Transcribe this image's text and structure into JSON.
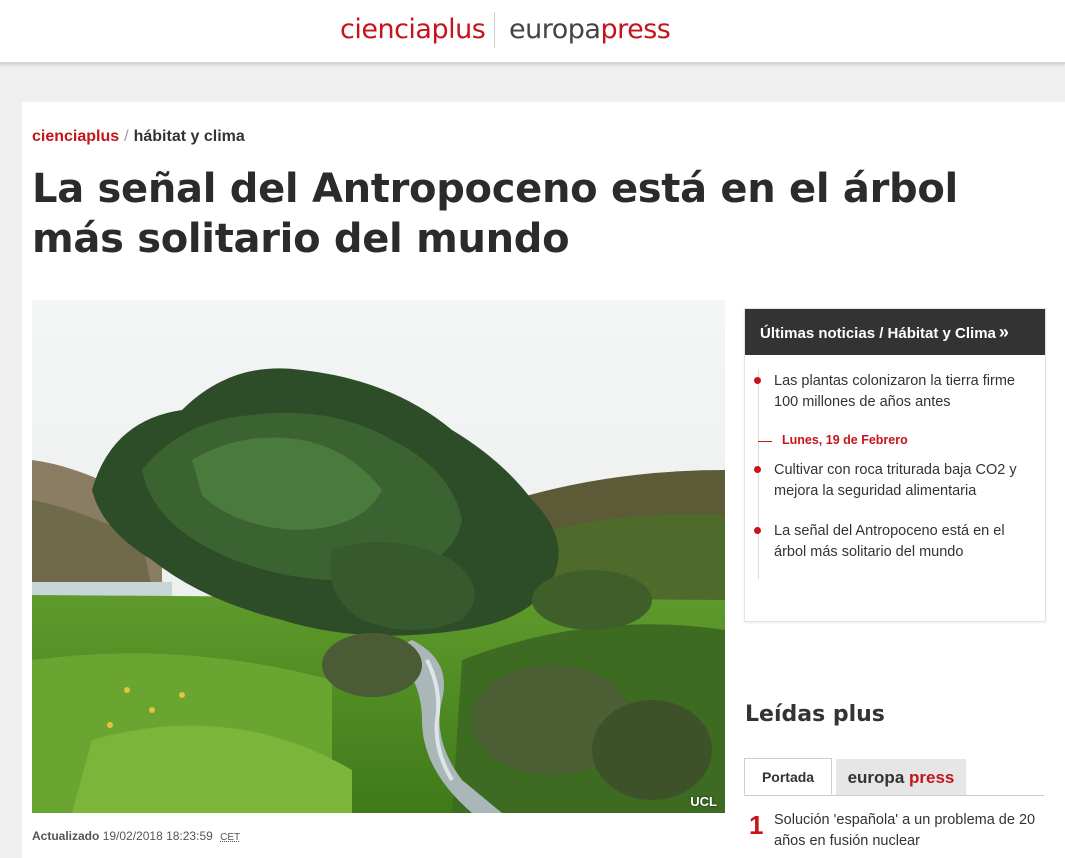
{
  "header": {
    "logo_cienciaplus": "cienciaplus",
    "logo_europa": "europa",
    "logo_press": "press"
  },
  "breadcrumb": {
    "home": "cienciaplus",
    "separator": "/",
    "section": "hábitat y clima"
  },
  "article": {
    "headline": "La señal del Antropoceno está en el árbol más solitario del mundo",
    "photo_credit": "UCL",
    "updated_label": "Actualizado",
    "updated_value": "19/02/2018 18:23:59",
    "timezone": "CET"
  },
  "sidebar": {
    "latest_title": "Últimas noticias / Hábitat y Clima",
    "latest_chevron": "»",
    "news": [
      "Las plantas colonizaron la tierra firme 100 millones de años antes",
      "Cultivar con roca triturada baja CO2 y mejora la seguridad alimentaria",
      "La señal del Antropoceno está en el árbol más solitario del mundo"
    ],
    "date_separator": "Lunes, 19 de Febrero",
    "most_read_title": "Leídas plus",
    "tabs": {
      "portada": "Portada",
      "ep_europa": "europa",
      "ep_press": "press"
    },
    "most_read": [
      {
        "rank": "1",
        "text": "Solución 'española' a un problema de 20 años en fusión nuclear"
      }
    ]
  },
  "colors": {
    "brand_red": "#c5141b",
    "header_dark": "#333333"
  }
}
